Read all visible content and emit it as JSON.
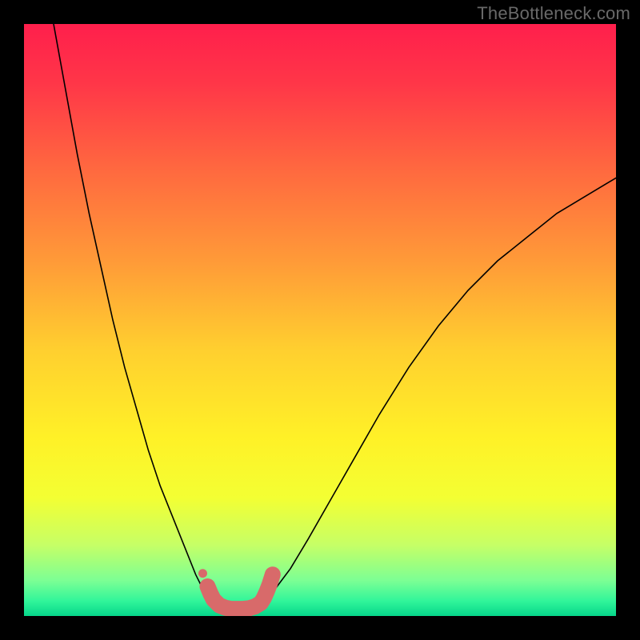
{
  "watermark": "TheBottleneck.com",
  "chart_data": {
    "type": "line",
    "title": "",
    "xlabel": "",
    "ylabel": "",
    "xlim": [
      0,
      100
    ],
    "ylim": [
      0,
      100
    ],
    "grid": false,
    "axes_visible": false,
    "background": {
      "type": "vertical-gradient",
      "stops": [
        {
          "offset": 0.0,
          "color": "#ff1f4c"
        },
        {
          "offset": 0.1,
          "color": "#ff3648"
        },
        {
          "offset": 0.25,
          "color": "#ff6a3f"
        },
        {
          "offset": 0.4,
          "color": "#ff9a38"
        },
        {
          "offset": 0.55,
          "color": "#ffcf2f"
        },
        {
          "offset": 0.7,
          "color": "#fff127"
        },
        {
          "offset": 0.8,
          "color": "#f3ff33"
        },
        {
          "offset": 0.88,
          "color": "#c6ff66"
        },
        {
          "offset": 0.94,
          "color": "#7cff94"
        },
        {
          "offset": 0.975,
          "color": "#30f59a"
        },
        {
          "offset": 1.0,
          "color": "#06d68a"
        }
      ]
    },
    "series": [
      {
        "name": "curve-left",
        "color": "#000000",
        "width": 1.6,
        "x": [
          5,
          7,
          9,
          11,
          13,
          15,
          17,
          19,
          21,
          23,
          25,
          27,
          29,
          30,
          31,
          32,
          33
        ],
        "y": [
          100,
          89,
          78,
          68,
          59,
          50,
          42,
          35,
          28,
          22,
          17,
          12,
          7,
          5,
          4,
          3,
          2.5
        ]
      },
      {
        "name": "curve-right",
        "color": "#000000",
        "width": 1.6,
        "x": [
          40,
          42,
          45,
          48,
          52,
          56,
          60,
          65,
          70,
          75,
          80,
          85,
          90,
          95,
          100
        ],
        "y": [
          2.5,
          4,
          8,
          13,
          20,
          27,
          34,
          42,
          49,
          55,
          60,
          64,
          68,
          71,
          74
        ]
      },
      {
        "name": "highlight-band",
        "type": "scatter",
        "color": "#d86a6a",
        "marker_size": 10,
        "x": [
          31,
          31.5,
          32,
          33,
          34,
          35,
          36,
          37,
          38,
          39,
          40,
          40.5,
          41,
          41.5,
          42
        ],
        "y": [
          5,
          3.8,
          2.8,
          1.8,
          1.4,
          1.2,
          1.2,
          1.2,
          1.3,
          1.6,
          2.2,
          3.0,
          4.1,
          5.4,
          7.0
        ]
      }
    ],
    "annotations": []
  }
}
